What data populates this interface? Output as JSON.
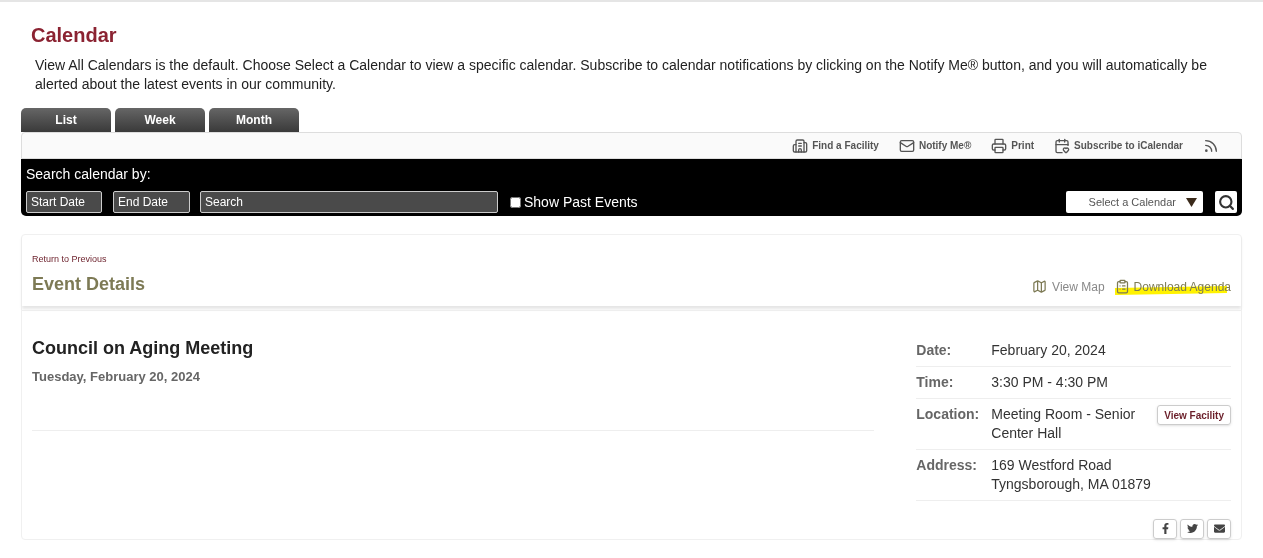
{
  "page_title": "Calendar",
  "intro": "View All Calendars is the default. Choose Select a Calendar to view a specific calendar. Subscribe to calendar notifications by clicking on the Notify Me® button, and you will automatically be alerted about the latest events in our community.",
  "tabs": [
    {
      "label": "List",
      "selected": false
    },
    {
      "label": "Week",
      "selected": false
    },
    {
      "label": "Month",
      "selected": false
    }
  ],
  "toolbar": [
    {
      "kind": "facility",
      "label": "Find a Facility"
    },
    {
      "kind": "notify",
      "label": "Notify Me®"
    },
    {
      "kind": "print",
      "label": "Print"
    },
    {
      "kind": "ical",
      "label": "Subscribe to iCalendar"
    },
    {
      "kind": "rss"
    }
  ],
  "search": {
    "heading": "Search calendar by:",
    "start_placeholder": "Start Date",
    "end_placeholder": "End Date",
    "search_placeholder": "Search",
    "past_events": {
      "label": "Show Past Events",
      "checked": false
    },
    "calendar_select": "Select a Calendar"
  },
  "event": {
    "back_link": "Return to Previous",
    "section_title": "Event Details",
    "view_map": "View Map",
    "download_agenda": {
      "label": "Download Agenda",
      "highlighted": true
    },
    "title": "Council on Aging Meeting",
    "date_heading": "Tuesday, February 20, 2024",
    "details": [
      {
        "label": "Date:",
        "value": "February 20, 2024"
      },
      {
        "label": "Time:",
        "value": "3:30 PM - 4:30 PM"
      },
      {
        "label": "Location:",
        "value": "Meeting Room - Senior Center Hall",
        "button": "View Facility"
      },
      {
        "label": "Address:",
        "lines": [
          "169 Westford Road",
          "Tyngsborough, MA 01879"
        ]
      }
    ],
    "share": [
      {
        "kind": "facebook"
      },
      {
        "kind": "twitter"
      },
      {
        "kind": "email"
      }
    ]
  }
}
